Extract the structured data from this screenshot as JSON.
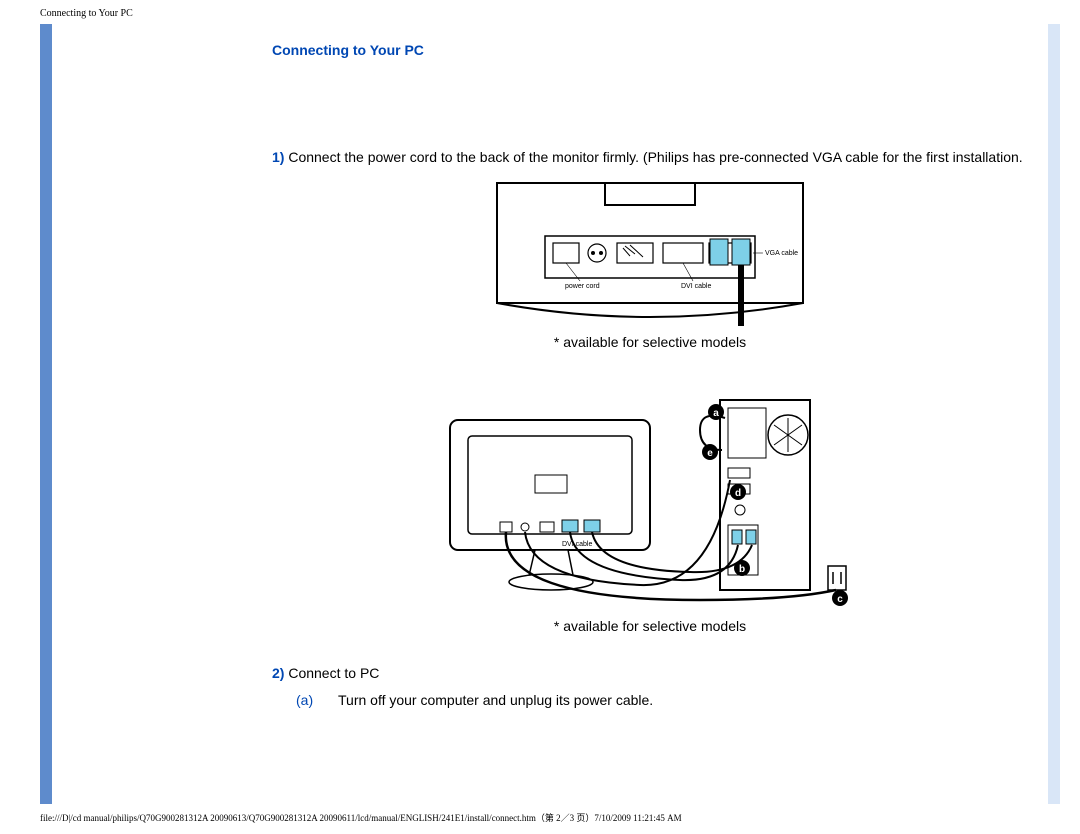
{
  "header": "Connecting to Your PC",
  "title": "Connecting to Your PC",
  "step1": {
    "num": "1)",
    "text": " Connect the power cord to the back of the monitor firmly. (Philips has pre-connected VGA cable for the first installation."
  },
  "note": "* available for selective models",
  "step2": {
    "num": "2)",
    "text": " Connect to PC",
    "sub_a_letter": "(a)",
    "sub_a_text": "Turn off your computer and unplug its power cable."
  },
  "diagram1_labels": {
    "vga": "VGA cable",
    "dvi": "DVI cable",
    "power": "power cord"
  },
  "diagram2_labels": {
    "dvi": "DVI cable"
  },
  "footer": "file:///D|/cd manual/philips/Q70G900281312A 20090613/Q70G900281312A 20090611/lcd/manual/ENGLISH/241E1/install/connect.htm（第 2／3 页）7/10/2009 11:21:45 AM"
}
